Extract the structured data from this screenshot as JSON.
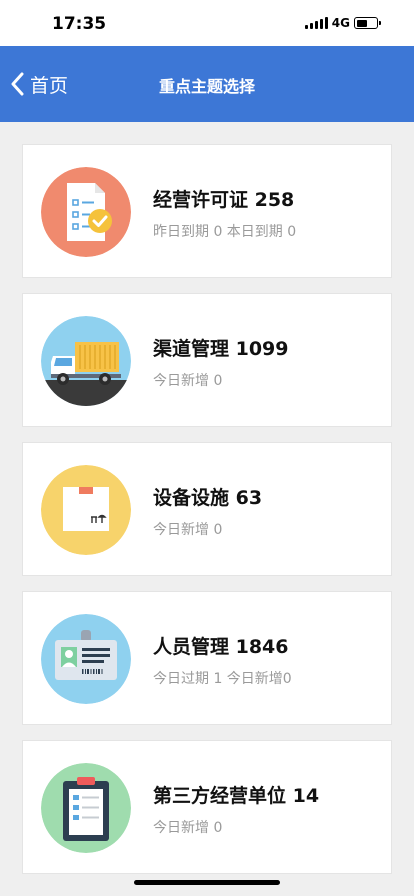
{
  "status_bar": {
    "time": "17:35",
    "network": "4G"
  },
  "nav": {
    "back_label": "首页",
    "title": "重点主题选择"
  },
  "cards": [
    {
      "title": "经营许可证 258",
      "subtitle": "昨日到期 0 本日到期 0",
      "icon": "license-document-icon",
      "icon_color": "#f08a6e"
    },
    {
      "title": "渠道管理 1099",
      "subtitle": "今日新增 0",
      "icon": "delivery-truck-icon",
      "icon_color": "#8fd1ef"
    },
    {
      "title": "设备设施 63",
      "subtitle": "今日新增 0",
      "icon": "package-box-icon",
      "icon_color": "#f7d36b"
    },
    {
      "title": "人员管理 1846",
      "subtitle": "今日过期 1 今日新增0",
      "icon": "id-badge-icon",
      "icon_color": "#8fd1ef"
    },
    {
      "title": "第三方经营单位 14",
      "subtitle": "今日新增 0",
      "icon": "clipboard-icon",
      "icon_color": "#9fdcae"
    }
  ]
}
